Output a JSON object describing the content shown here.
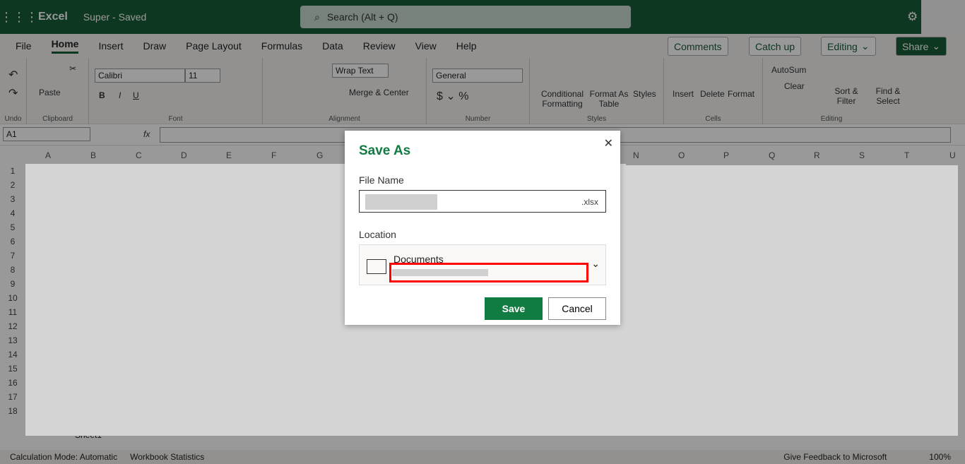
{
  "header": {
    "app": "Excel",
    "doc_title": "Super - Saved",
    "search_placeholder": "Search (Alt + Q)"
  },
  "tabs": [
    "File",
    "Home",
    "Insert",
    "Draw",
    "Page Layout",
    "Formulas",
    "Data",
    "Review",
    "View",
    "Help"
  ],
  "right_buttons": {
    "comments": "Comments",
    "catch_up": "Catch up",
    "editing": "Editing",
    "share": "Share"
  },
  "ribbon": {
    "undo": "Undo",
    "clipboard": "Clipboard",
    "paste": "Paste",
    "font_group": "Font",
    "font": "Calibri",
    "size": "11",
    "alignment": "Alignment",
    "wrap": "Wrap Text",
    "merge": "Merge & Center",
    "number_group": "Number",
    "number_format": "General",
    "cond": "Conditional Formatting",
    "fmt_table": "Format As Table",
    "styles": "Styles",
    "styles_group": "Styles",
    "insert": "Insert",
    "delete": "Delete",
    "format": "Format",
    "cells_group": "Cells",
    "autosum": "AutoSum",
    "clear": "Clear",
    "sort": "Sort & Filter",
    "find": "Find & Select",
    "editing_group": "Editing"
  },
  "formula_bar": {
    "name_box": "A1",
    "fx": "fx"
  },
  "columns": [
    "A",
    "B",
    "C",
    "D",
    "E",
    "F",
    "G",
    "N",
    "O",
    "P",
    "Q",
    "R",
    "S",
    "T",
    "U"
  ],
  "rows": [
    "1",
    "2",
    "3",
    "4",
    "5",
    "6",
    "7",
    "8",
    "9",
    "10",
    "11",
    "12",
    "13",
    "14",
    "15",
    "16",
    "17",
    "18"
  ],
  "sheet_tab": "Sheet1",
  "status": {
    "calc": "Calculation Mode: Automatic",
    "stats": "Workbook Statistics",
    "feedback": "Give Feedback to Microsoft",
    "zoom": "100%"
  },
  "dialog": {
    "title": "Save As",
    "file_name_label": "File Name",
    "extension": ".xlsx",
    "location_label": "Location",
    "location": "Documents",
    "save": "Save",
    "cancel": "Cancel"
  },
  "colors": {
    "brand": "#185c37",
    "accent": "#107c41",
    "highlight": "#ff0000"
  }
}
